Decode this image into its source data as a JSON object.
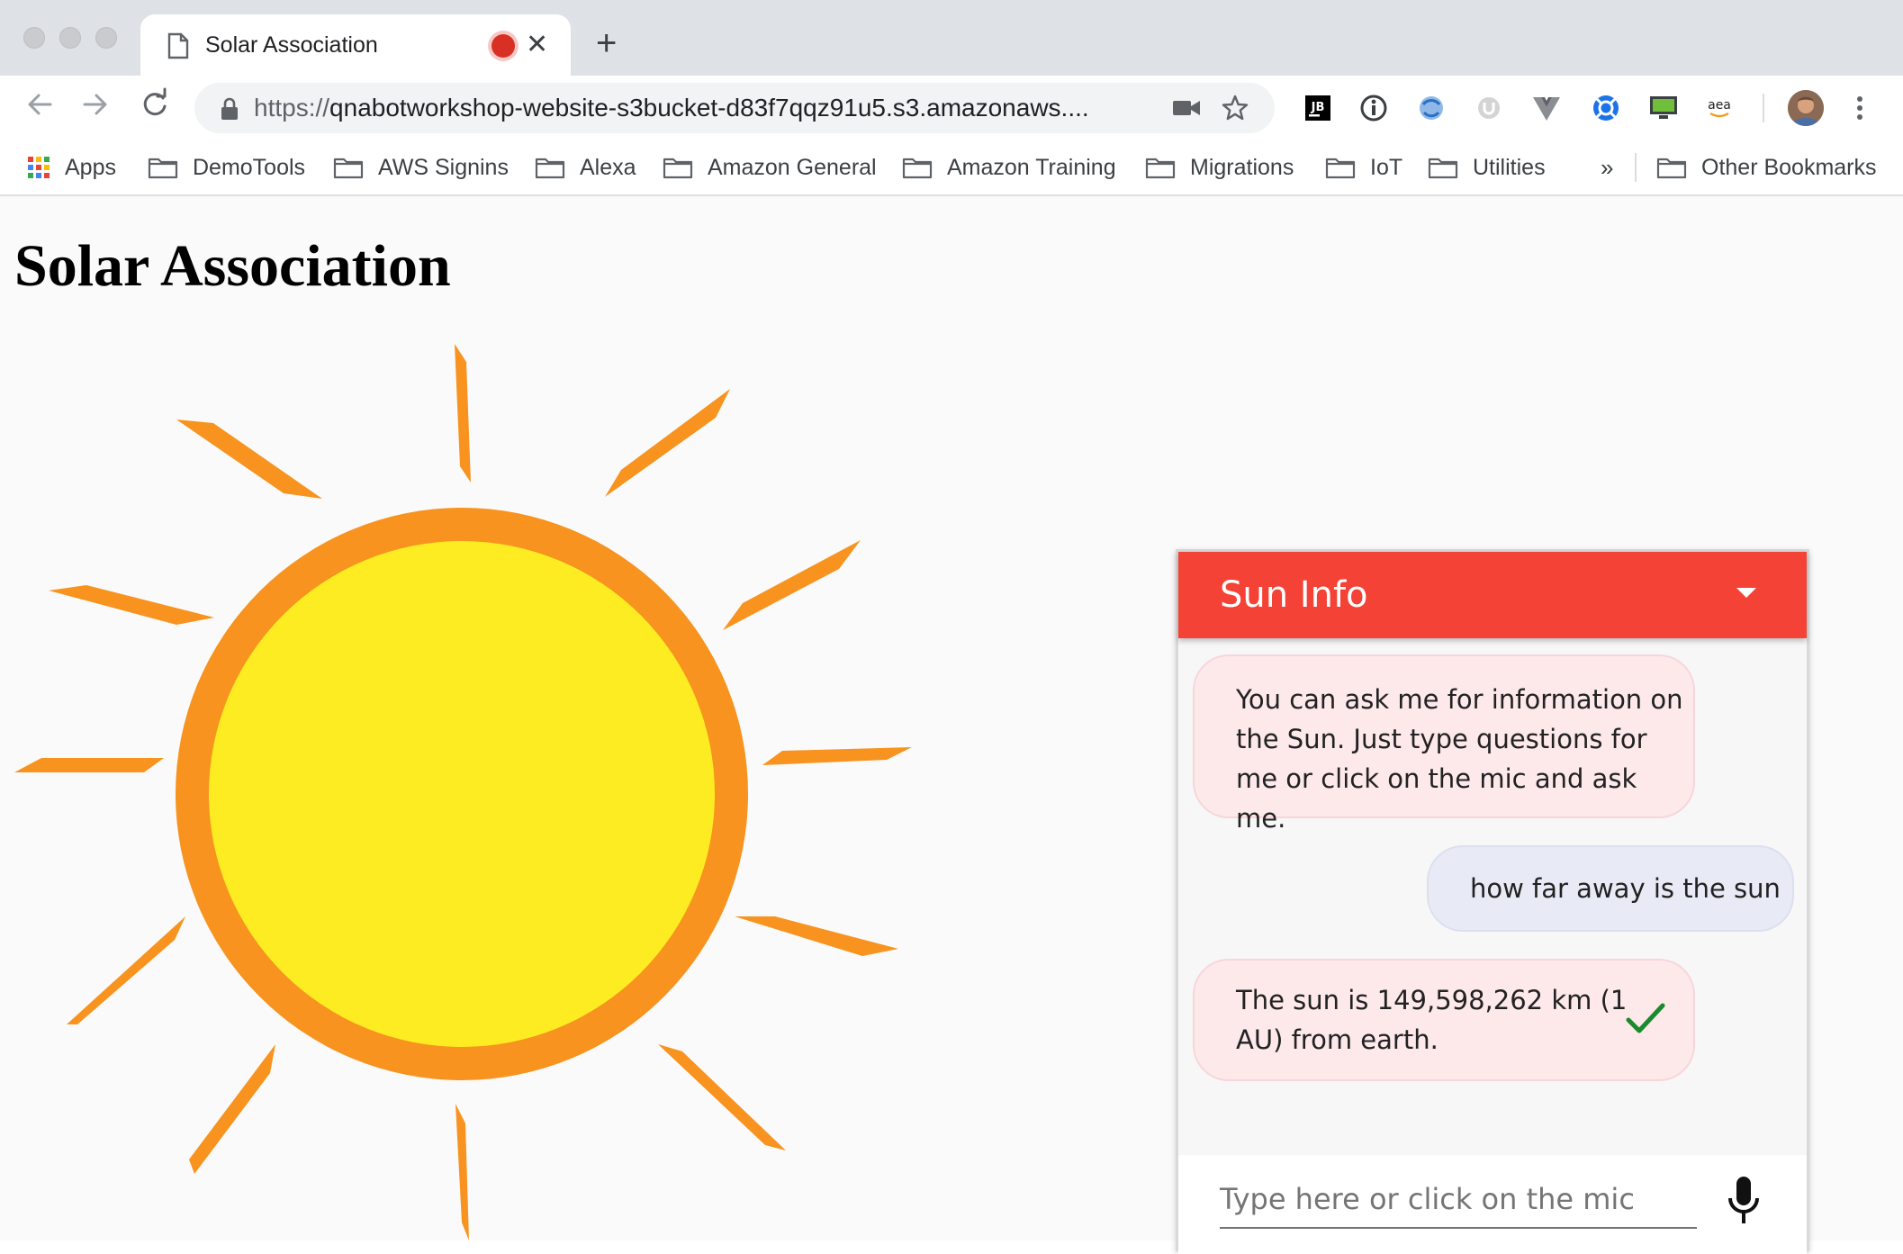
{
  "browser": {
    "tab": {
      "title": "Solar Association"
    },
    "omnibox": {
      "url_scheme": "https://",
      "url_rest": "qnabotworkshop-website-s3bucket-d83f7qqz91u5.s3.amazonaws...."
    },
    "extensions": [
      "jetbrains-icon",
      "info-icon",
      "translate-icon",
      "ublock-icon",
      "vue-icon",
      "crosshair-icon",
      "monitor-icon",
      "amazon-assistant-icon"
    ],
    "extension_labels": {
      "jetbrains": "JB",
      "amazon": "aea"
    },
    "bookmarks": [
      {
        "label": "Apps",
        "icon": "apps-grid-icon"
      },
      {
        "label": "DemoTools",
        "icon": "folder-icon"
      },
      {
        "label": "AWS Signins",
        "icon": "folder-icon"
      },
      {
        "label": "Alexa",
        "icon": "folder-icon"
      },
      {
        "label": "Amazon General",
        "icon": "folder-icon"
      },
      {
        "label": "Amazon Training",
        "icon": "folder-icon"
      },
      {
        "label": "Migrations",
        "icon": "folder-icon"
      },
      {
        "label": "IoT",
        "icon": "folder-icon"
      },
      {
        "label": "Utilities",
        "icon": "folder-icon"
      }
    ],
    "bookmarks_overflow": "»",
    "other_bookmarks": "Other Bookmarks"
  },
  "page": {
    "title": "Solar Association"
  },
  "chat": {
    "title": "Sun Info",
    "messages": [
      {
        "from": "bot",
        "lines": [
          "You can ask me for information on",
          "the Sun. Just type questions for",
          "me or click on the mic and ask me."
        ]
      },
      {
        "from": "user",
        "lines": [
          "how far away is the sun"
        ]
      },
      {
        "from": "bot",
        "lines": [
          "The sun is 149,598,262 km (1",
          "AU) from earth."
        ],
        "icon": "checkmark-icon"
      }
    ],
    "input_placeholder": "Type here or click on the mic"
  },
  "colors": {
    "chat_header": "#f44336",
    "sun_core": "#fdec22",
    "sun_ring": "#f7931e",
    "check": "#1b8a2e"
  }
}
